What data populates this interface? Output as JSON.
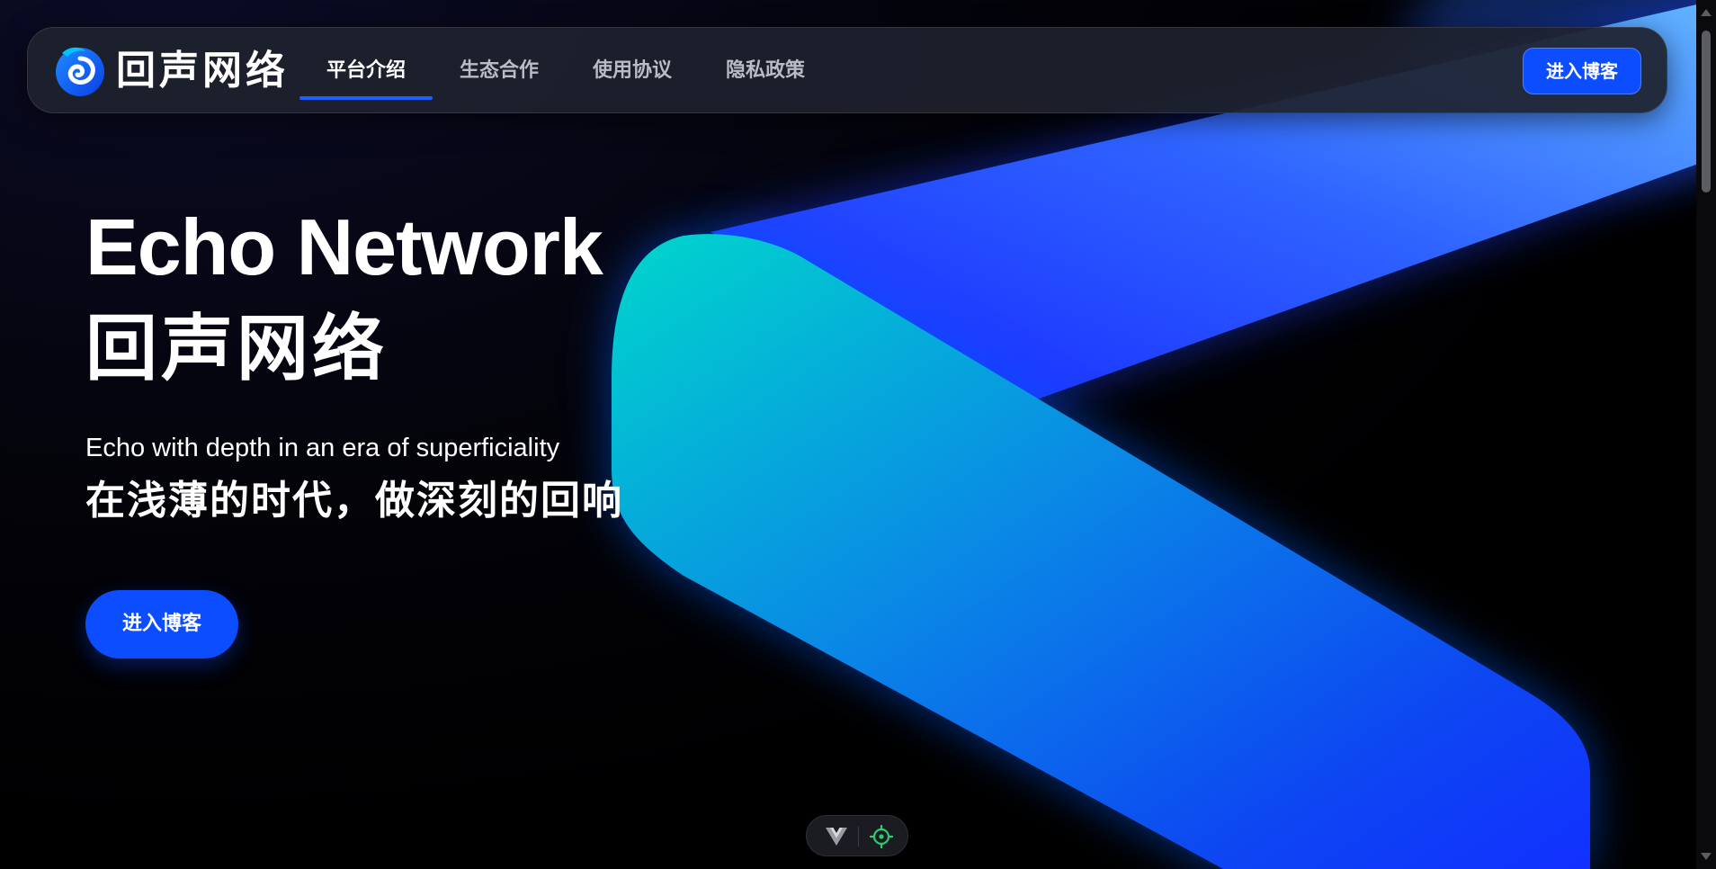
{
  "brand": {
    "name": "回声网络",
    "logo_icon": "echo-swirl-logo-icon"
  },
  "nav": {
    "items": [
      {
        "label": "平台介绍",
        "active": true
      },
      {
        "label": "生态合作",
        "active": false
      },
      {
        "label": "使用协议",
        "active": false
      },
      {
        "label": "隐私政策",
        "active": false
      }
    ],
    "cta_label": "进入博客"
  },
  "hero": {
    "title_en": "Echo Network",
    "title_zh": "回声网络",
    "subtitle_en": "Echo with depth in an era of superficiality",
    "subtitle_zh": "在浅薄的时代，做深刻的回响",
    "button_label": "进入博客"
  },
  "devtools": {
    "icons": [
      "vue-logo-icon",
      "target-icon"
    ]
  },
  "colors": {
    "accent": "#0b4dff",
    "ribbon_cyan": "#00d4d0",
    "ribbon_blue": "#1f3dff",
    "nav_active_underline": "#1f5eff",
    "devtool_green": "#2ecc71"
  }
}
